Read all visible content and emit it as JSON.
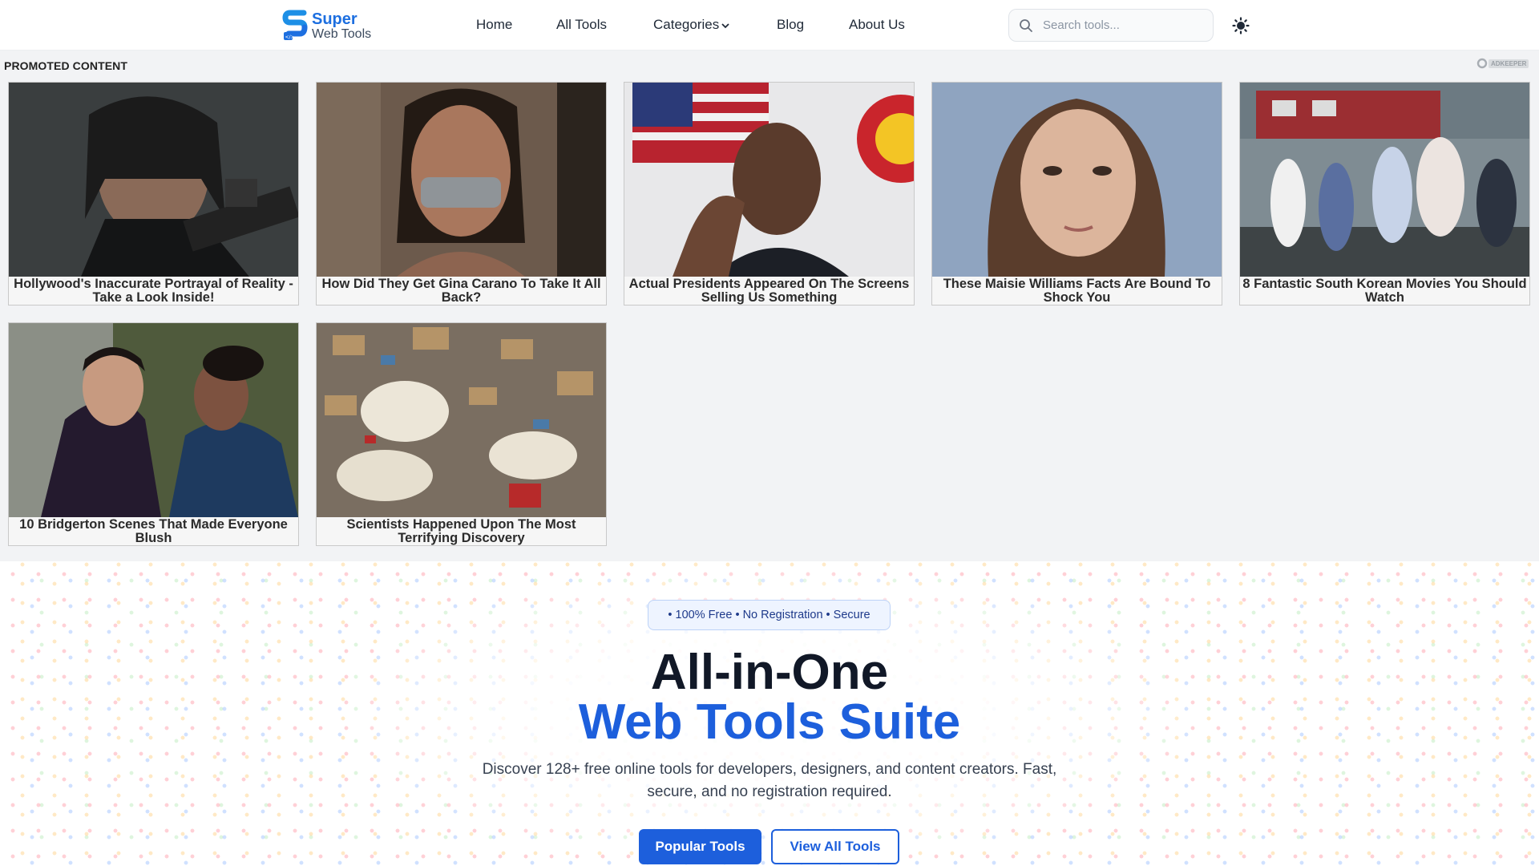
{
  "brand": {
    "name_top": "Super",
    "name_bottom": "Web Tools",
    "logo_icon": "s-logo-icon",
    "color": "#1d6fe0"
  },
  "nav": {
    "items": [
      {
        "label": "Home"
      },
      {
        "label": "All Tools"
      },
      {
        "label": "Categories",
        "icon": "chevron-down-icon"
      },
      {
        "label": "Blog"
      },
      {
        "label": "About Us"
      }
    ]
  },
  "search": {
    "placeholder": "Search tools...",
    "value": "",
    "icon": "search-icon"
  },
  "theme_toggle": {
    "icon": "sun-icon"
  },
  "promoted": {
    "label": "PROMOTED CONTENT",
    "provider": "ADKEEPER",
    "cards": [
      {
        "title": "Hollywood's Inaccurate Portrayal of Reality - Take a Look Inside!"
      },
      {
        "title": "How Did They Get Gina Carano To Take It All Back?"
      },
      {
        "title": "Actual Presidents Appeared On The Screens Selling Us Something"
      },
      {
        "title": "These Maisie Williams Facts Are Bound To Shock You"
      },
      {
        "title": "8 Fantastic South Korean Movies You Should Watch"
      },
      {
        "title": "10 Bridgerton Scenes That Made Everyone Blush"
      },
      {
        "title": "Scientists Happened Upon The Most Terrifying Discovery"
      }
    ]
  },
  "hero": {
    "badge": "• 100% Free • No Registration • Secure",
    "title_line1": "All-in-One",
    "title_line2": "Web Tools Suite",
    "subtitle": "Discover 128+ free online tools for developers, designers, and content creators. Fast, secure, and no registration required.",
    "primary_button": "Popular Tools",
    "secondary_button": "View All Tools",
    "accent": "#1d5fdc"
  }
}
